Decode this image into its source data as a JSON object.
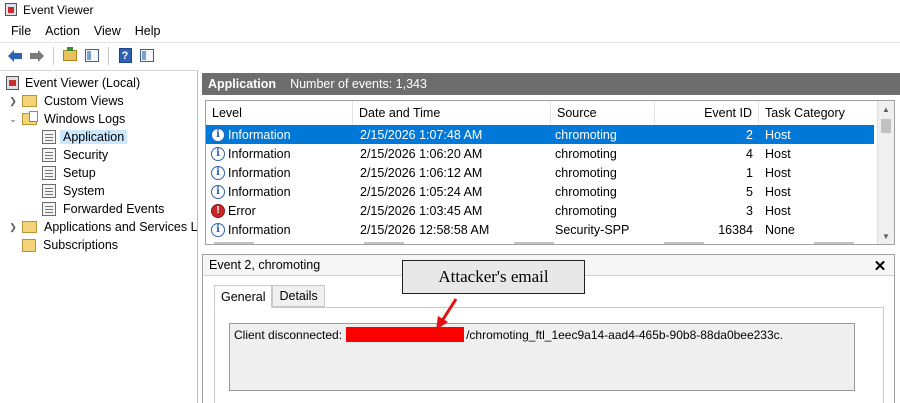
{
  "window": {
    "title": "Event Viewer"
  },
  "menu": [
    "File",
    "Action",
    "View",
    "Help"
  ],
  "toolbar": {
    "back_icon": "arrow-left-icon",
    "forward_icon": "arrow-right-icon",
    "help_label": "?"
  },
  "tree": {
    "root": "Event Viewer (Local)",
    "custom_views": "Custom Views",
    "windows_logs": "Windows Logs",
    "logs": [
      "Application",
      "Security",
      "Setup",
      "System",
      "Forwarded Events"
    ],
    "apps_services": "Applications and Services Lo",
    "subscriptions": "Subscriptions",
    "selected": "Application"
  },
  "header": {
    "title": "Application",
    "count_text": "Number of events: 1,343"
  },
  "grid": {
    "columns": [
      "Level",
      "Date and Time",
      "Source",
      "Event ID",
      "Task Category"
    ],
    "rows": [
      {
        "level": "Information",
        "date": "2/15/2026 1:07:48 AM",
        "source": "chromoting",
        "id": "2",
        "category": "Host",
        "icon": "i"
      },
      {
        "level": "Information",
        "date": "2/15/2026 1:06:20 AM",
        "source": "chromoting",
        "id": "4",
        "category": "Host",
        "icon": "i"
      },
      {
        "level": "Information",
        "date": "2/15/2026 1:06:12 AM",
        "source": "chromoting",
        "id": "1",
        "category": "Host",
        "icon": "i"
      },
      {
        "level": "Information",
        "date": "2/15/2026 1:05:24 AM",
        "source": "chromoting",
        "id": "5",
        "category": "Host",
        "icon": "i"
      },
      {
        "level": "Error",
        "date": "2/15/2026 1:03:45 AM",
        "source": "chromoting",
        "id": "3",
        "category": "Host",
        "icon": "!"
      },
      {
        "level": "Information",
        "date": "2/15/2026 12:58:58 AM",
        "source": "Security-SPP",
        "id": "16384",
        "category": "None",
        "icon": "i"
      }
    ]
  },
  "detail": {
    "title": "Event 2, chromoting",
    "tabs": [
      "General",
      "Details"
    ],
    "message_prefix": "Client disconnected:",
    "message_suffix": "/chromoting_ftl_1eec9a14-aad4-465b-90b8-88da0bee233c."
  },
  "annotation": {
    "label": "Attacker's email"
  },
  "colors": {
    "selection": "#0078d7",
    "redaction": "#ff0000",
    "header_bar": "#6d6d6d"
  }
}
